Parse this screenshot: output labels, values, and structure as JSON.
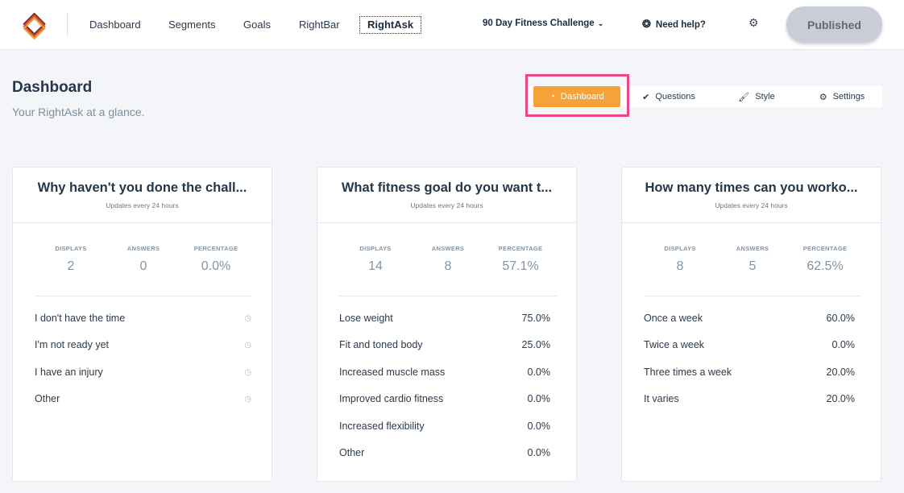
{
  "nav": {
    "items": [
      "Dashboard",
      "Segments",
      "Goals",
      "RightBar",
      "RightAsk"
    ],
    "active": "RightAsk",
    "challenge": "90 Day Fitness Challenge",
    "help": "Need help?",
    "published": "Published"
  },
  "icons": {
    "logo": "stacked-layers-logo",
    "help": "lifebuoy-icon",
    "settings": "gear-icon",
    "dropdown": "chevron-down-icon"
  },
  "page": {
    "title": "Dashboard",
    "subtitle": "Your RightAsk at a glance."
  },
  "tabs": [
    {
      "label": "Dashboard",
      "icon": "speedometer-icon",
      "glyph": "◔"
    },
    {
      "label": "Questions",
      "icon": "checkmark-icon",
      "glyph": "✔"
    },
    {
      "label": "Style",
      "icon": "brush-icon",
      "glyph": "🖌"
    },
    {
      "label": "Settings",
      "icon": "gear-icon",
      "glyph": "⚙"
    }
  ],
  "stat_labels": {
    "displays": "DISPLAYS",
    "answers": "ANSWERS",
    "percentage": "PERCENTAGE"
  },
  "colors": {
    "accent": "#f6a23a",
    "highlight": "#ee4786",
    "published_bg": "#c9ced6"
  },
  "cards": [
    {
      "title": "Why haven't you done the chall...",
      "updates": "Updates every 24 hours",
      "displays": "2",
      "answers": "0",
      "percentage": "0.0%",
      "rows": [
        {
          "label": "I don't have the time",
          "value": ""
        },
        {
          "label": "I'm not ready yet",
          "value": ""
        },
        {
          "label": "I have an injury",
          "value": ""
        },
        {
          "label": "Other",
          "value": ""
        }
      ]
    },
    {
      "title": "What fitness goal do you want t...",
      "updates": "Updates every 24 hours",
      "displays": "14",
      "answers": "8",
      "percentage": "57.1%",
      "rows": [
        {
          "label": "Lose weight",
          "value": "75.0%"
        },
        {
          "label": "Fit and toned body",
          "value": "25.0%"
        },
        {
          "label": "Increased muscle mass",
          "value": "0.0%"
        },
        {
          "label": "Improved cardio fitness",
          "value": "0.0%"
        },
        {
          "label": "Increased flexibility",
          "value": "0.0%"
        },
        {
          "label": "Other",
          "value": "0.0%"
        }
      ]
    },
    {
      "title": "How many times can you worko...",
      "updates": "Updates every 24 hours",
      "displays": "8",
      "answers": "5",
      "percentage": "62.5%",
      "rows": [
        {
          "label": "Once a week",
          "value": "60.0%"
        },
        {
          "label": "Twice a week",
          "value": "0.0%"
        },
        {
          "label": "Three times a week",
          "value": "20.0%"
        },
        {
          "label": "It varies",
          "value": "20.0%"
        }
      ]
    }
  ]
}
